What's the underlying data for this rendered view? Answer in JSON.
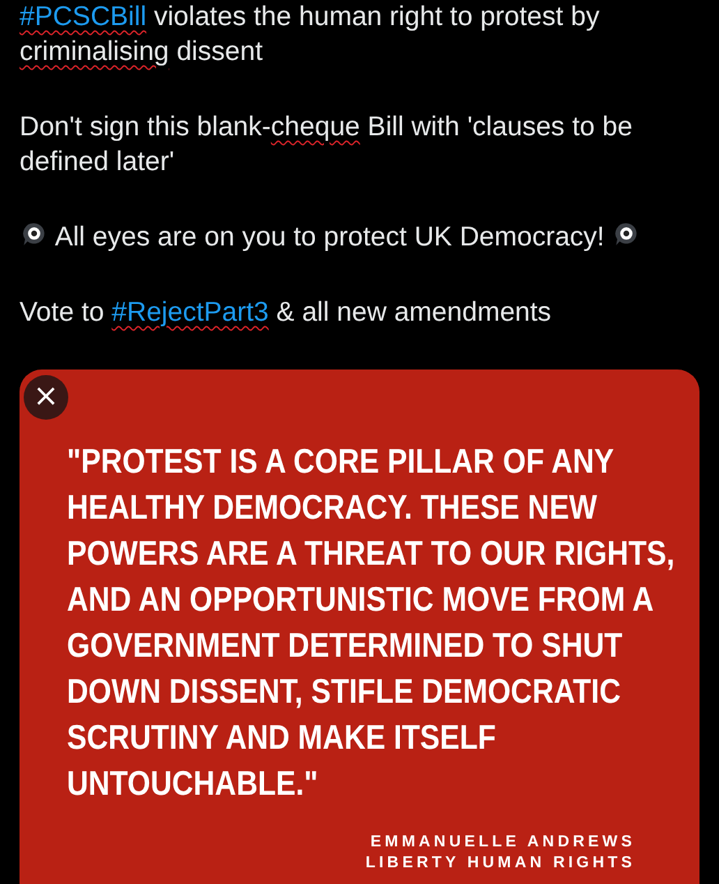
{
  "tweet": {
    "paragraphs": [
      {
        "segments": [
          {
            "text": "#PCSCBill",
            "kind": "hashtag",
            "misspelled": true
          },
          {
            "text": " violates the human right to protest by ",
            "kind": "plain",
            "misspelled": false
          },
          {
            "text": "criminalising",
            "kind": "plain",
            "misspelled": true
          },
          {
            "text": " dissent",
            "kind": "plain",
            "misspelled": false
          }
        ]
      },
      {
        "segments": [
          {
            "text": "Don't sign this blank-",
            "kind": "plain",
            "misspelled": false
          },
          {
            "text": "cheque",
            "kind": "plain",
            "misspelled": true
          },
          {
            "text": " Bill with 'clauses to be defined later'",
            "kind": "plain",
            "misspelled": false
          }
        ]
      },
      {
        "segments": [
          {
            "kind": "eye"
          },
          {
            "text": " All eyes are on you to protect UK Democracy! ",
            "kind": "plain",
            "misspelled": false
          },
          {
            "kind": "eye"
          }
        ]
      },
      {
        "segments": [
          {
            "text": "Vote to ",
            "kind": "plain",
            "misspelled": false
          },
          {
            "text": "#RejectPart3",
            "kind": "hashtag",
            "misspelled": true
          },
          {
            "text": " & all new amendments",
            "kind": "plain",
            "misspelled": false
          }
        ]
      }
    ]
  },
  "image_card": {
    "close_label": "×",
    "quote_lines": [
      "\"PROTEST IS A CORE PILLAR OF ANY",
      "HEALTHY DEMOCRACY. THESE NEW",
      "POWERS ARE A THREAT TO OUR RIGHTS,",
      "AND AN OPPORTUNISTIC MOVE FROM A",
      "GOVERNMENT DETERMINED TO SHUT",
      "DOWN DISSENT, STIFLE DEMOCRATIC",
      "SCRUTINY AND MAKE ITSELF",
      "UNTOUCHABLE.\""
    ],
    "attribution": [
      "EMMANUELLE ANDREWS",
      "LIBERTY HUMAN RIGHTS"
    ]
  }
}
